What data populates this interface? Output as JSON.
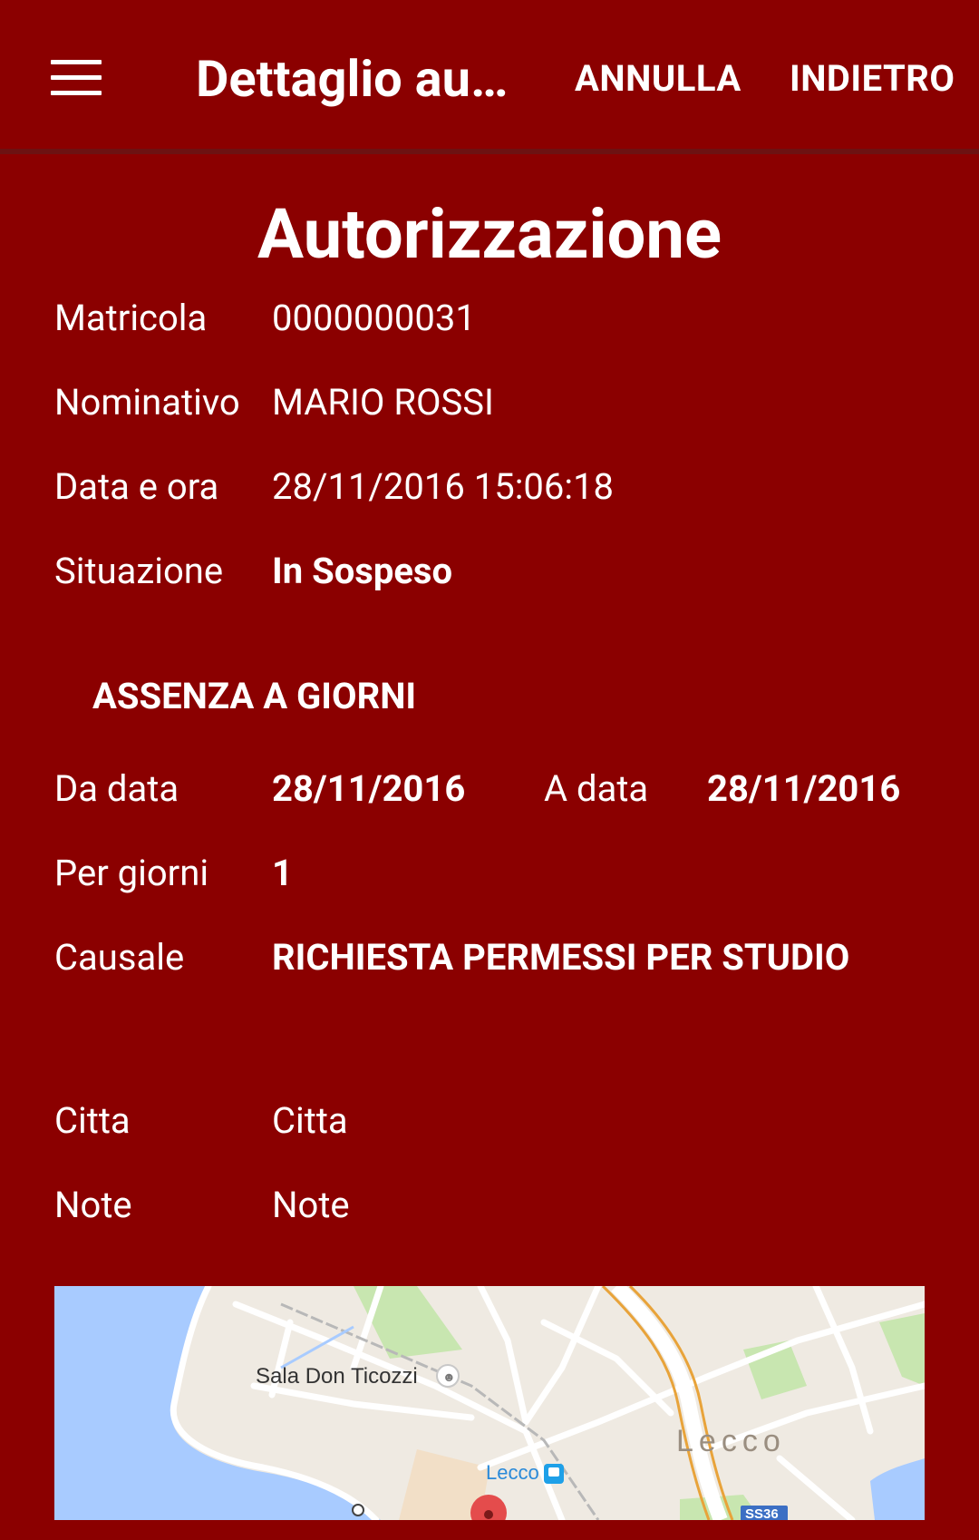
{
  "appbar": {
    "title": "Dettaglio au…",
    "cancel_label": "ANNULLA",
    "back_label": "INDIETRO"
  },
  "heading": "Autorizzazione",
  "fields": {
    "matricola": {
      "label": "Matricola",
      "value": "0000000031"
    },
    "nominativo": {
      "label": "Nominativo",
      "value": "MARIO ROSSI"
    },
    "data_ora": {
      "label": "Data e ora",
      "value": "28/11/2016 15:06:18"
    },
    "situazione": {
      "label": "Situazione",
      "value": "In Sospeso"
    }
  },
  "section_title": "ASSENZA A GIORNI",
  "absence": {
    "from_label": "Da data",
    "from_value": "28/11/2016",
    "to_label": "A data",
    "to_value": "28/11/2016",
    "days_label": "Per giorni",
    "days_value": "1",
    "reason_label": "Causale",
    "reason_value": "RICHIESTA PERMESSI PER STUDIO"
  },
  "extra": {
    "city_label": "Citta",
    "city_value": "Citta",
    "note_label": "Note",
    "note_value": "Note"
  },
  "map": {
    "poi_label": "Sala Don Ticozzi",
    "station_label": "Lecco",
    "city_label": "Lecco",
    "road_badge": "SS36",
    "water_color": "#a8cbff",
    "land_color": "#efeae2",
    "park_color": "#c8e6b0",
    "highway_color": "#e8a33a",
    "marker_color": "#e44c4c"
  }
}
